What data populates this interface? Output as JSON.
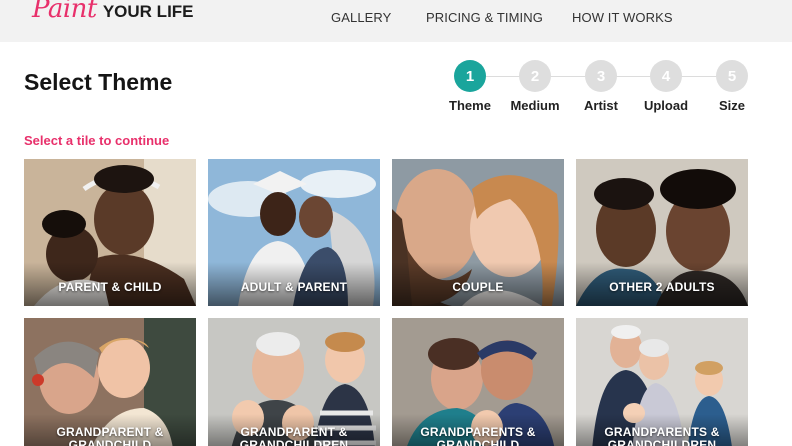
{
  "header": {
    "logo_paint": "Paint",
    "logo_rest": "YOUR LIFE",
    "nav": [
      "GALLERY",
      "PRICING & TIMING",
      "HOW IT WORKS"
    ]
  },
  "page": {
    "title": "Select Theme",
    "prompt": "Select a tile to continue"
  },
  "steps": [
    {
      "number": "1",
      "label": "Theme",
      "active": true
    },
    {
      "number": "2",
      "label": "Medium",
      "active": false
    },
    {
      "number": "3",
      "label": "Artist",
      "active": false
    },
    {
      "number": "4",
      "label": "Upload",
      "active": false
    },
    {
      "number": "5",
      "label": "Size",
      "active": false
    }
  ],
  "tiles": [
    {
      "label": "PARENT & CHILD"
    },
    {
      "label": "ADULT & PARENT"
    },
    {
      "label": "COUPLE"
    },
    {
      "label": "OTHER 2 ADULTS"
    },
    {
      "label": "GRANDPARENT & GRANDCHILD"
    },
    {
      "label": "GRANDPARENT & GRANDCHILDREN"
    },
    {
      "label": "GRANDPARENTS & GRANDCHILD"
    },
    {
      "label": "GRANDPARENTS & GRANDCHILDREN"
    }
  ],
  "colors": {
    "brand_pink": "#e8306b",
    "step_active": "#1aa59c",
    "step_inactive": "#dedede"
  }
}
